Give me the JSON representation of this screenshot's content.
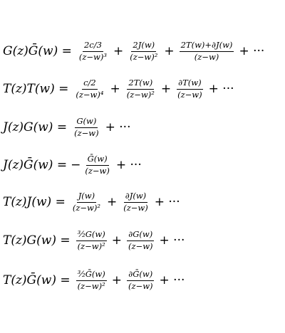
{
  "equations": [
    {
      "lhs": "G(z)Ḡ(w) =",
      "terms": [
        {
          "sign": "",
          "num": "2c/3",
          "den": "(z−w)³"
        },
        {
          "sign": "+",
          "num": "2J(w)",
          "den": "(z−w)²"
        },
        {
          "sign": "+",
          "num": "2T(w)+∂J(w)",
          "den": "(z−w)"
        }
      ],
      "tail": "+ ···"
    },
    {
      "lhs": "T(z)T(w) =",
      "terms": [
        {
          "sign": "",
          "num": "c/2",
          "den": "(z−w)⁴"
        },
        {
          "sign": "+",
          "num": "2T(w)",
          "den": "(z−w)²"
        },
        {
          "sign": "+",
          "num": "∂T(w)",
          "den": "(z−w)"
        }
      ],
      "tail": "+ ···"
    },
    {
      "lhs": "J(z)G(w) =",
      "terms": [
        {
          "sign": "",
          "num": "G(w)",
          "den": "(z−w)"
        }
      ],
      "tail": "+ ···"
    },
    {
      "lhs": "J(z)Ḡ(w) =",
      "terms": [
        {
          "sign": "−",
          "num": "Ḡ(w)",
          "den": "(z−w)"
        }
      ],
      "tail": "+ ···"
    },
    {
      "lhs": "T(z)J(w) =",
      "terms": [
        {
          "sign": "",
          "num": "J(w)",
          "den": "(z−w)²"
        },
        {
          "sign": "+",
          "num": "∂J(w)",
          "den": "(z−w)"
        }
      ],
      "tail": "+ ···"
    },
    {
      "lhs": "T(z)G(w) =",
      "terms": [
        {
          "sign": "",
          "num": "³⁄₂G(w)",
          "den": "(z−w)²"
        },
        {
          "sign": "+",
          "num": "∂G(w)",
          "den": "(z−w)"
        }
      ],
      "tail": "+ ···"
    },
    {
      "lhs": "T(z)Ḡ(w) =",
      "terms": [
        {
          "sign": "",
          "num": "³⁄₂Ḡ(w)",
          "den": "(z−w)²"
        },
        {
          "sign": "+",
          "num": "∂Ḡ(w)",
          "den": "(z−w)"
        }
      ],
      "tail": "+ ···"
    }
  ]
}
